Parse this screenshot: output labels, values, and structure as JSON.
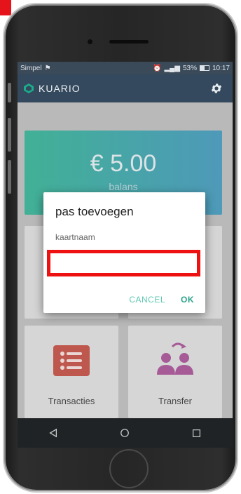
{
  "statusbar": {
    "carrier": "Simpel",
    "battery_percent": "53%",
    "time": "10:17",
    "battery_level": 0.53
  },
  "appbar": {
    "title": "KUARIO",
    "settings_icon": "gear-icon"
  },
  "balance": {
    "amount": "€ 5.00",
    "label": "balans"
  },
  "tiles": [
    {
      "label": "Transacties",
      "icon": "list-icon"
    },
    {
      "label": "Transfer",
      "icon": "users-transfer-icon"
    }
  ],
  "dialog": {
    "title": "pas toevoegen",
    "field_label": "kaartnaam",
    "input_value": "",
    "cancel_label": "CANCEL",
    "ok_label": "OK"
  },
  "navbar": {
    "back_icon": "back-triangle-icon",
    "home_icon": "home-circle-icon",
    "recents_icon": "recents-square-icon"
  },
  "colors": {
    "appbar": "#34495e",
    "card_start": "#1aae8a",
    "card_end": "#2a8fb9",
    "accent": "#2aa38a",
    "highlight": "#ee1111"
  }
}
